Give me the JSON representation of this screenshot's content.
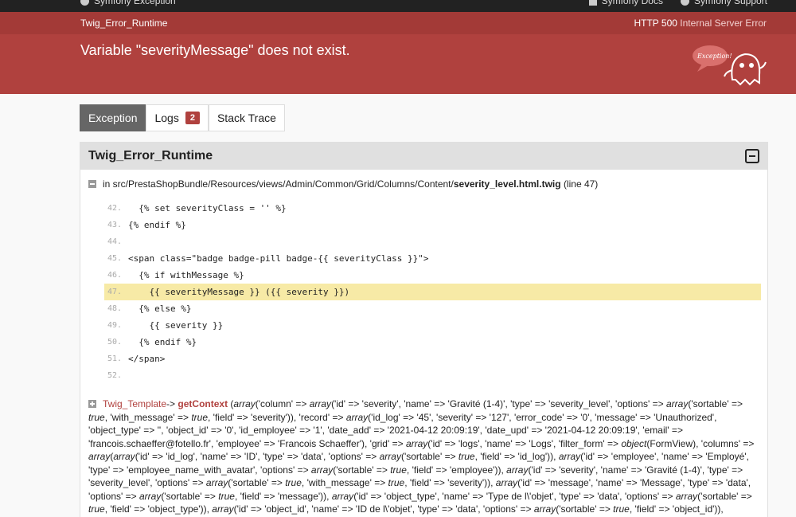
{
  "topbar": {
    "brand": "Symfony Exception",
    "links": [
      "Symfony Docs",
      "Symfony Support"
    ]
  },
  "header": {
    "exception_class": "Twig_Error_Runtime",
    "status_code": "HTTP 500",
    "status_text": "Internal Server Error",
    "message": "Variable \"severityMessage\" does not exist.",
    "ghost_label": "Exception!"
  },
  "tabs": [
    {
      "label": "Exception",
      "active": true
    },
    {
      "label": "Logs",
      "badge": "2"
    },
    {
      "label": "Stack Trace"
    }
  ],
  "panel": {
    "title": "Twig_Error_Runtime",
    "trace_prefix": "in src/PrestaShopBundle/Resources/views/Admin/Common/Grid/Columns/Content/",
    "trace_file": "severity_level.html.twig",
    "trace_line": "(line 47)",
    "code": [
      {
        "num": "42.",
        "text": "  {% set severityClass = '' %}"
      },
      {
        "num": "43.",
        "text": "{% endif %}"
      },
      {
        "num": "44.",
        "text": ""
      },
      {
        "num": "45.",
        "text": "<span class=\"badge badge-pill badge-{{ severityClass }}\">"
      },
      {
        "num": "46.",
        "text": "  {% if withMessage %}"
      },
      {
        "num": "47.",
        "text": "    {{ severityMessage }} ({{ severity }})",
        "highlight": true
      },
      {
        "num": "48.",
        "text": "  {% else %}"
      },
      {
        "num": "49.",
        "text": "    {{ severity }}"
      },
      {
        "num": "50.",
        "text": "  {% endif %}"
      },
      {
        "num": "51.",
        "text": "</span>"
      },
      {
        "num": "52.",
        "text": ""
      }
    ],
    "frame_class": "Twig_Template",
    "frame_arrow": "->",
    "frame_method": "getContext",
    "frame_args": "(array('column' => array('id' => 'severity', 'name' => 'Gravité (1-4)', 'type' => 'severity_level', 'options' => array('sortable' => true, 'with_message' => true, 'field' => 'severity')), 'record' => array('id_log' => '45', 'severity' => '127', 'error_code' => '0', 'message' => 'Unauthorized', 'object_type' => '', 'object_id' => '0', 'id_employee' => '1', 'date_add' => '2021-04-12 20:09:19', 'date_upd' => '2021-04-12 20:09:19', 'email' => 'francois.schaeffer@fotello.fr', 'employee' => 'Francois Schaeffer'), 'grid' => array('id' => 'logs', 'name' => 'Logs', 'filter_form' => object(FormView), 'columns' => array(array('id' => 'id_log', 'name' => 'ID', 'type' => 'data', 'options' => array('sortable' => true, 'field' => 'id_log')), array('id' => 'employee', 'name' => 'Employé', 'type' => 'employee_name_with_avatar', 'options' => array('sortable' => true, 'field' => 'employee')), array('id' => 'severity', 'name' => 'Gravité (1-4)', 'type' => 'severity_level', 'options' => array('sortable' => true, 'with_message' => true, 'field' => 'severity')), array('id' => 'message', 'name' => 'Message', 'type' => 'data', 'options' => array('sortable' => true, 'field' => 'message')), array('id' => 'object_type', 'name' => 'Type de l\\'objet', 'type' => 'data', 'options' => array('sortable' => true, 'field' => 'object_type')), array('id' => 'object_id', 'name' => 'ID de l\\'objet', 'type' => 'data', 'options' => array('sortable' => true, 'field' => 'object_id')),"
  },
  "colors": {
    "header_bg": "#b0413e",
    "highlight": "#f7eaa6",
    "tab_active": "#666666"
  }
}
